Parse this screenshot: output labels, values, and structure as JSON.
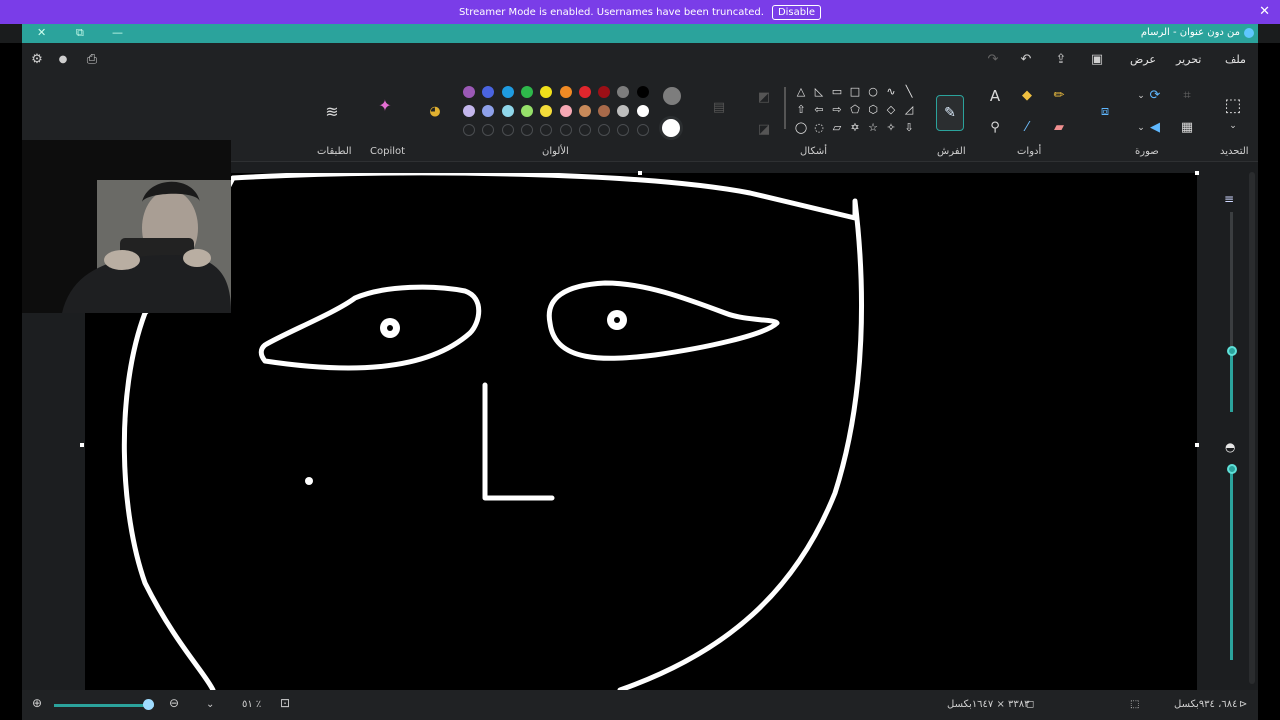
{
  "streamer": {
    "message": "Streamer Mode is enabled. Usernames have been truncated.",
    "disable_label": "Disable",
    "close_icon": "close-icon"
  },
  "window": {
    "title": "من دون عنوان - الرسام"
  },
  "menu": {
    "file": "ملف",
    "edit": "تحرير",
    "view": "عرض"
  },
  "ribbon": {
    "select": "التحديد",
    "image": "صورة",
    "tools": "أدوات",
    "brushes": "الفرش",
    "shapes": "أشكال",
    "colors": "الألوان",
    "copilot": "Copilot",
    "layers": "الطبقات"
  },
  "palette": {
    "row1": [
      "#9b59b6",
      "#4a64e0",
      "#1e9be0",
      "#2eb84b",
      "#f0e01a",
      "#f08a24",
      "#e0262d",
      "#9c0f16",
      "#7d7d7d",
      "#000000"
    ],
    "row2": [
      "#c3b6ec",
      "#8ea0ea",
      "#8fd6ea",
      "#96e06a",
      "#f4dc3a",
      "#f6a8b4",
      "#c88a5a",
      "#a86a4a",
      "#bdbdbd",
      "#ffffff"
    ],
    "color1": "#7d7d7d",
    "color2": "#ffffff"
  },
  "status": {
    "cursor_pos": "٦٨٤، ٩٣٤بكسل",
    "canvas_size": "٣٣٨٣ × ١٦٤٧بكسل",
    "zoom": "٥١ ٪"
  }
}
